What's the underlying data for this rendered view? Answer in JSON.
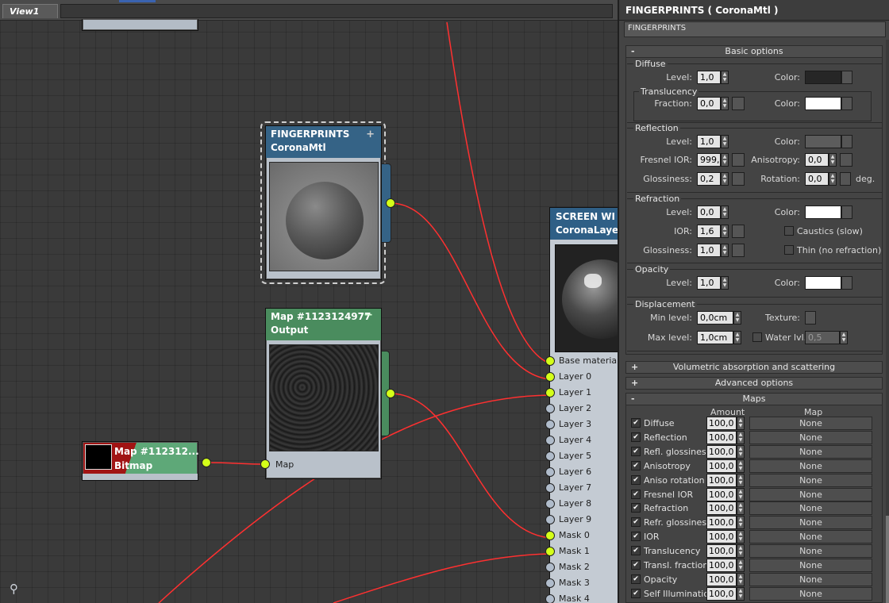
{
  "viewport": {
    "tab_label": "View1"
  },
  "nodes": {
    "fingerprints": {
      "title": "FINGERPRINTS",
      "subtitle": "CoronaMtl",
      "plus": "+"
    },
    "map_output": {
      "title": "Map #1123124977",
      "subtitle": "Output",
      "minus": "−",
      "slot_label": "Map"
    },
    "bitmap": {
      "title": "Map #112312...",
      "subtitle": "Bitmap"
    },
    "layered": {
      "title": "SCREEN WI",
      "subtitle": "CoronaLaye",
      "slots": [
        "Base material",
        "Layer 0",
        "Layer 1",
        "Layer 2",
        "Layer 3",
        "Layer 4",
        "Layer 5",
        "Layer 6",
        "Layer 7",
        "Layer 8",
        "Layer 9",
        "Mask 0",
        "Mask 1",
        "Mask 2",
        "Mask 3",
        "Mask 4"
      ],
      "connected": [
        true,
        true,
        true,
        false,
        false,
        false,
        false,
        false,
        false,
        false,
        false,
        true,
        true,
        false,
        false,
        false
      ]
    }
  },
  "panel": {
    "title": "FINGERPRINTS  ( CoronaMtl )",
    "name_field": "FINGERPRINTS",
    "basic": {
      "header": "Basic options",
      "toggle": "-",
      "diffuse": {
        "title": "Diffuse",
        "level_label": "Level:",
        "level": "1,0",
        "color_label": "Color:",
        "color": "#262626",
        "translucency": {
          "title": "Translucency",
          "fraction_label": "Fraction:",
          "fraction": "0,0",
          "color_label": "Color:",
          "color": "#ffffff"
        }
      },
      "reflection": {
        "title": "Reflection",
        "level_label": "Level:",
        "level": "1,0",
        "color_label": "Color:",
        "color": "#5c5c5c",
        "fresnel_label": "Fresnel IOR:",
        "fresnel": "999,0",
        "aniso_label": "Anisotropy:",
        "aniso": "0,0",
        "gloss_label": "Glossiness:",
        "gloss": "0,2",
        "rot_label": "Rotation:",
        "rot": "0,0",
        "deg": "deg."
      },
      "refraction": {
        "title": "Refraction",
        "level_label": "Level:",
        "level": "0,0",
        "color_label": "Color:",
        "color": "#ffffff",
        "ior_label": "IOR:",
        "ior": "1,6",
        "caustics": "Caustics (slow)",
        "gloss_label": "Glossiness:",
        "gloss": "1,0",
        "thin": "Thin (no refraction)"
      },
      "opacity": {
        "title": "Opacity",
        "level_label": "Level:",
        "level": "1,0",
        "color_label": "Color:",
        "color": "#ffffff"
      },
      "displacement": {
        "title": "Displacement",
        "min_label": "Min level:",
        "min": "0,0cm",
        "tex_label": "Texture:",
        "max_label": "Max level:",
        "max": "1,0cm",
        "water_label": "Water lvl.",
        "water": "0,5"
      }
    },
    "volumetric": {
      "header": "Volumetric absorption and scattering",
      "toggle": "+"
    },
    "advanced": {
      "header": "Advanced options",
      "toggle": "+"
    },
    "maps": {
      "header": "Maps",
      "toggle": "-",
      "col_amount": "Amount",
      "col_map": "Map",
      "rows": [
        {
          "name": "Diffuse",
          "amount": "100,0",
          "map": "None"
        },
        {
          "name": "Reflection",
          "amount": "100,0",
          "map": "None"
        },
        {
          "name": "Refl. glossiness",
          "amount": "100,0",
          "map": "None"
        },
        {
          "name": "Anisotropy",
          "amount": "100,0",
          "map": "None"
        },
        {
          "name": "Aniso rotation",
          "amount": "100,0",
          "map": "None"
        },
        {
          "name": "Fresnel IOR",
          "amount": "100,0",
          "map": "None"
        },
        {
          "name": "Refraction",
          "amount": "100,0",
          "map": "None"
        },
        {
          "name": "Refr. glossiness",
          "amount": "100,0",
          "map": "None"
        },
        {
          "name": "IOR",
          "amount": "100,0",
          "map": "None"
        },
        {
          "name": "Translucency",
          "amount": "100,0",
          "map": "None"
        },
        {
          "name": "Transl. fraction",
          "amount": "100,0",
          "map": "None"
        },
        {
          "name": "Opacity",
          "amount": "100,0",
          "map": "None"
        },
        {
          "name": "Self Illumination",
          "amount": "100,0",
          "map": "None"
        }
      ]
    }
  }
}
